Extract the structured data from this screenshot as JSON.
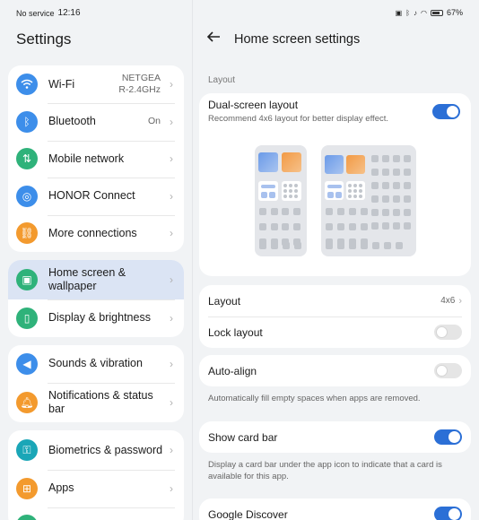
{
  "status_bar": {
    "carrier": "No service",
    "time": "12:16",
    "battery": "67%"
  },
  "left": {
    "title": "Settings",
    "groups": [
      [
        {
          "label": "Wi-Fi",
          "value": "NETGEA\nR-2.4GHz",
          "color": "#3d8eea",
          "icon": "wifi-icon"
        },
        {
          "label": "Bluetooth",
          "value": "On",
          "color": "#3d8eea",
          "icon": "bluetooth-icon"
        },
        {
          "label": "Mobile network",
          "value": "",
          "color": "#2fb27a",
          "icon": "signal-icon"
        },
        {
          "label": "HONOR Connect",
          "value": "",
          "color": "#3d8eea",
          "icon": "connect-icon"
        },
        {
          "label": "More connections",
          "value": "",
          "color": "#f39a2e",
          "icon": "link-icon"
        }
      ],
      [
        {
          "label": "Home screen & wallpaper",
          "value": "",
          "color": "#2fb27a",
          "icon": "image-icon",
          "selected": true
        },
        {
          "label": "Display & brightness",
          "value": "",
          "color": "#2fb27a",
          "icon": "phone-icon"
        }
      ],
      [
        {
          "label": "Sounds & vibration",
          "value": "",
          "color": "#3d8eea",
          "icon": "speaker-icon"
        },
        {
          "label": "Notifications & status bar",
          "value": "",
          "color": "#f39a2e",
          "icon": "bell-icon"
        }
      ],
      [
        {
          "label": "Biometrics & password",
          "value": "",
          "color": "#1aa6b7",
          "icon": "key-icon"
        },
        {
          "label": "Apps",
          "value": "",
          "color": "#f39a2e",
          "icon": "apps-icon"
        }
      ]
    ]
  },
  "right": {
    "title": "Home screen settings",
    "section": "Layout",
    "dual_title": "Dual-screen layout",
    "dual_desc": "Recommend 4x6 layout for better display effect.",
    "layout_label": "Layout",
    "layout_value": "4x6",
    "lock_label": "Lock layout",
    "auto_label": "Auto-align",
    "auto_note": "Automatically fill empty spaces when apps are removed.",
    "card_label": "Show card bar",
    "card_note": "Display a card bar under the app icon to indicate that a card is available for this app.",
    "discover_label": "Google Discover"
  },
  "colors": {
    "accent": "#2b6fd6",
    "selected_bg": "#dbe4f4"
  }
}
